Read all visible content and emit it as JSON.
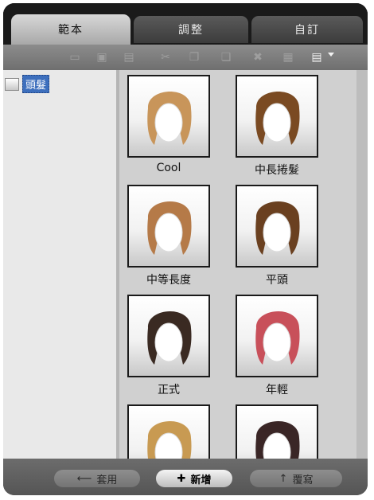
{
  "tabs": [
    {
      "label": "範本",
      "active": true
    },
    {
      "label": "調整",
      "active": false
    },
    {
      "label": "自訂",
      "active": false
    }
  ],
  "tree": {
    "items": [
      {
        "label": "頭髮",
        "selected": true
      }
    ]
  },
  "gallery": {
    "items": [
      {
        "label": "Cool",
        "hair_color": "#c8955a"
      },
      {
        "label": "中長捲髮",
        "hair_color": "#7a4a22"
      },
      {
        "label": "中等長度",
        "hair_color": "#b57a48"
      },
      {
        "label": "平頭",
        "hair_color": "#6a4020"
      },
      {
        "label": "正式",
        "hair_color": "#3a2a22"
      },
      {
        "label": "年輕",
        "hair_color": "#c8505a"
      },
      {
        "label": "",
        "hair_color": "#c89a52"
      },
      {
        "label": "",
        "hair_color": "#3a2626"
      }
    ]
  },
  "bottom": {
    "apply_label": "套用",
    "add_label": "新增",
    "overwrite_label": "覆寫"
  }
}
